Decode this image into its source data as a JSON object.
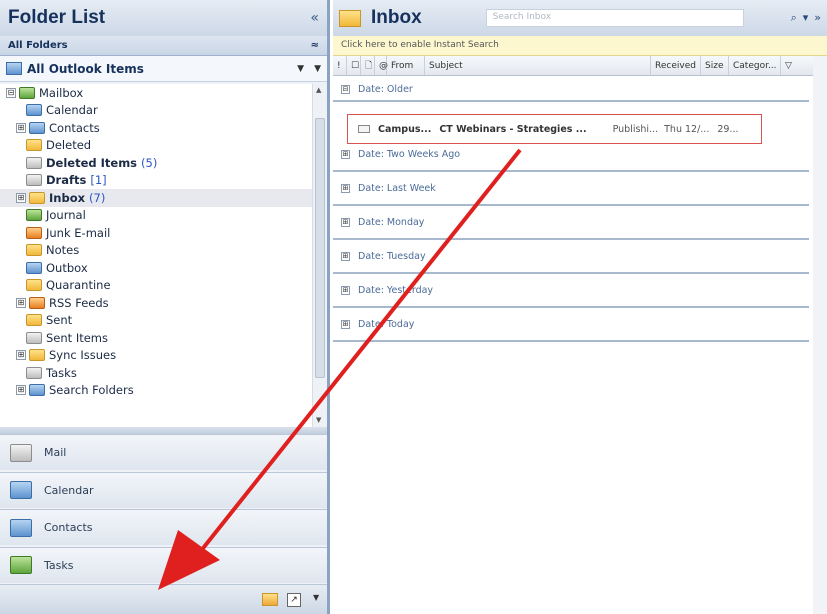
{
  "left": {
    "title": "Folder List",
    "collapse": "«",
    "all_folders": "All Folders",
    "all_folders_toggle": "≈",
    "all_items": "All Outlook Items",
    "tree": [
      {
        "label": "Mailbox",
        "exp": "⊟",
        "bold": false,
        "count": "",
        "icon": "f-green"
      },
      {
        "label": "Calendar",
        "exp": "",
        "bold": false,
        "count": "",
        "icon": "f-blue"
      },
      {
        "label": "Contacts",
        "exp": "⊞",
        "bold": false,
        "count": "",
        "icon": "f-blue"
      },
      {
        "label": "Deleted",
        "exp": "",
        "bold": false,
        "count": "",
        "icon": "f-yellow"
      },
      {
        "label": "Deleted Items",
        "exp": "",
        "bold": true,
        "count": "(5)",
        "icon": "f-gray"
      },
      {
        "label": "Drafts",
        "exp": "",
        "bold": true,
        "count": "[1]",
        "icon": "f-gray"
      },
      {
        "label": "Inbox",
        "exp": "⊞",
        "bold": true,
        "count": "(7)",
        "icon": "f-yellow",
        "selected": true
      },
      {
        "label": "Journal",
        "exp": "",
        "bold": false,
        "count": "",
        "icon": "f-green"
      },
      {
        "label": "Junk E-mail",
        "exp": "",
        "bold": false,
        "count": "",
        "icon": "f-orange"
      },
      {
        "label": "Notes",
        "exp": "",
        "bold": false,
        "count": "",
        "icon": "f-yellow"
      },
      {
        "label": "Outbox",
        "exp": "",
        "bold": false,
        "count": "",
        "icon": "f-blue"
      },
      {
        "label": "Quarantine",
        "exp": "",
        "bold": false,
        "count": "",
        "icon": "f-yellow"
      },
      {
        "label": "RSS Feeds",
        "exp": "⊞",
        "bold": false,
        "count": "",
        "icon": "f-orange"
      },
      {
        "label": "Sent",
        "exp": "",
        "bold": false,
        "count": "",
        "icon": "f-yellow"
      },
      {
        "label": "Sent Items",
        "exp": "",
        "bold": false,
        "count": "",
        "icon": "f-gray"
      },
      {
        "label": "Sync Issues",
        "exp": "⊞",
        "bold": false,
        "count": "",
        "icon": "f-yellow"
      },
      {
        "label": "Tasks",
        "exp": "",
        "bold": false,
        "count": "",
        "icon": "f-gray"
      },
      {
        "label": "Search Folders",
        "exp": "⊞",
        "bold": false,
        "count": "",
        "icon": "f-blue"
      }
    ],
    "nav": [
      {
        "label": "Mail",
        "name": "nav-mail",
        "icon": "f-gray"
      },
      {
        "label": "Calendar",
        "name": "nav-calendar",
        "icon": "f-blue"
      },
      {
        "label": "Contacts",
        "name": "nav-contacts",
        "icon": "f-blue"
      },
      {
        "label": "Tasks",
        "name": "nav-tasks",
        "icon": "f-green"
      }
    ]
  },
  "right": {
    "title": "Inbox",
    "search_placeholder": "Search Inbox",
    "search_buttons": [
      "⌕",
      "▾",
      "»"
    ],
    "instant_search": "Click here to enable Instant Search",
    "columns": [
      "!",
      "☐",
      "🗋",
      "@",
      "From",
      "Subject",
      "Received",
      "Size",
      "Categor...",
      "▽"
    ],
    "groups": [
      "Date: Older",
      "Date: Two Weeks Ago",
      "Date: Last Week",
      "Date: Monday",
      "Date: Tuesday",
      "Date: Yesterday",
      "Date: Today"
    ],
    "message": {
      "from": "Campus...",
      "subject": "CT Webinars - Strategies ...",
      "category": "Publishi...",
      "received": "Thu 12/...",
      "size": "29..."
    }
  },
  "colors": {
    "accent": "#15315c",
    "arrow": "#e0201e",
    "highlight": "#d9534f"
  }
}
